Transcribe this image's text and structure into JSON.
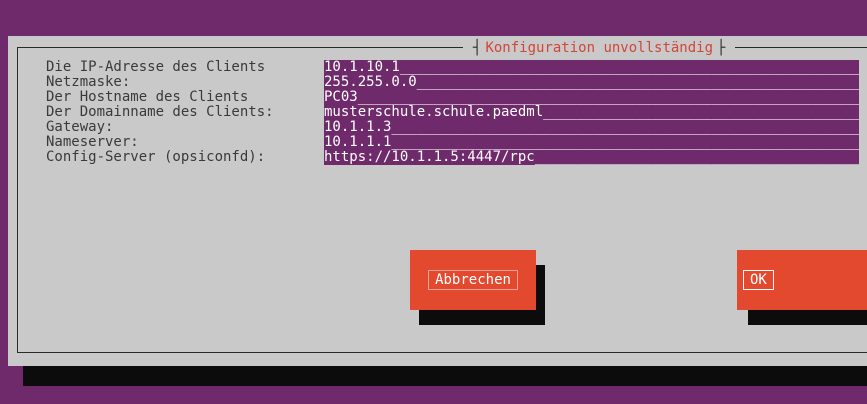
{
  "dialog": {
    "title": "Konfiguration unvollständig"
  },
  "form": {
    "rows": [
      {
        "label": "Die IP-Adresse des Clients",
        "value": "10.1.10.1"
      },
      {
        "label": "Netzmaske:",
        "value": "255.255.0.0"
      },
      {
        "label": "Der Hostname des Clients",
        "value": "PC03"
      },
      {
        "label": "Der Domainname des Clients:",
        "value": "musterschule.schule.paedml"
      },
      {
        "label": "Gateway:",
        "value": "10.1.1.3"
      },
      {
        "label": "Nameserver:",
        "value": "10.1.1.1"
      },
      {
        "label": "Config-Server (opsiconfd):",
        "value": "https://10.1.1.5:4447/rpc"
      }
    ],
    "fill_char": "_"
  },
  "buttons": {
    "cancel_label": "Abbrechen",
    "ok_label": "OK"
  },
  "colors": {
    "background": "#6f2a6b",
    "dialog": "#c9c9c9",
    "accent": "#e2492f",
    "title_text": "#d3453a"
  }
}
